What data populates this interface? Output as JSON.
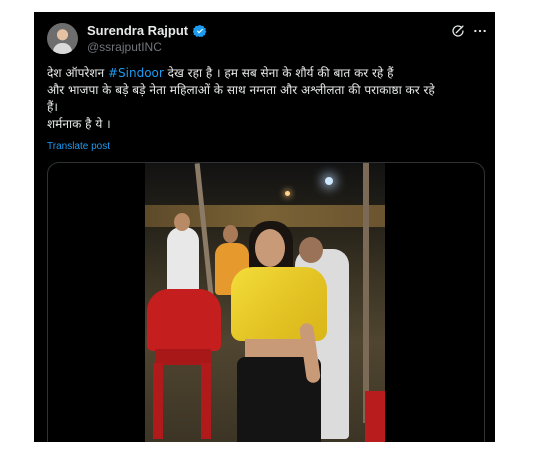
{
  "post": {
    "author": {
      "display_name": "Surendra Rajput",
      "handle": "@ssrajputINC",
      "verified": true
    },
    "text_lines": [
      {
        "before": "देश ऑपरेशन ",
        "hashtag": "#Sindoor",
        "after": " देख रहा है । हम सब सेना के शौर्य की बात कर रहे हैं"
      },
      {
        "text": "और भाजपा के बड़े बड़े नेता महिलाओं के साथ नग्नता और अश्लीलता की पराकाष्ठा कर रहे"
      },
      {
        "text": "हैं।"
      },
      {
        "text": "शर्मनाक है ये ।"
      }
    ],
    "translate_label": "Translate post",
    "media": {
      "kind": "video-still"
    }
  },
  "icons": {
    "verified": "verified-badge-icon",
    "grok": "grok-icon",
    "more": "more-options-icon"
  },
  "colors": {
    "background": "#000000",
    "text": "#e7e9ea",
    "secondary_text": "#71767b",
    "accent": "#1d9bf0"
  }
}
